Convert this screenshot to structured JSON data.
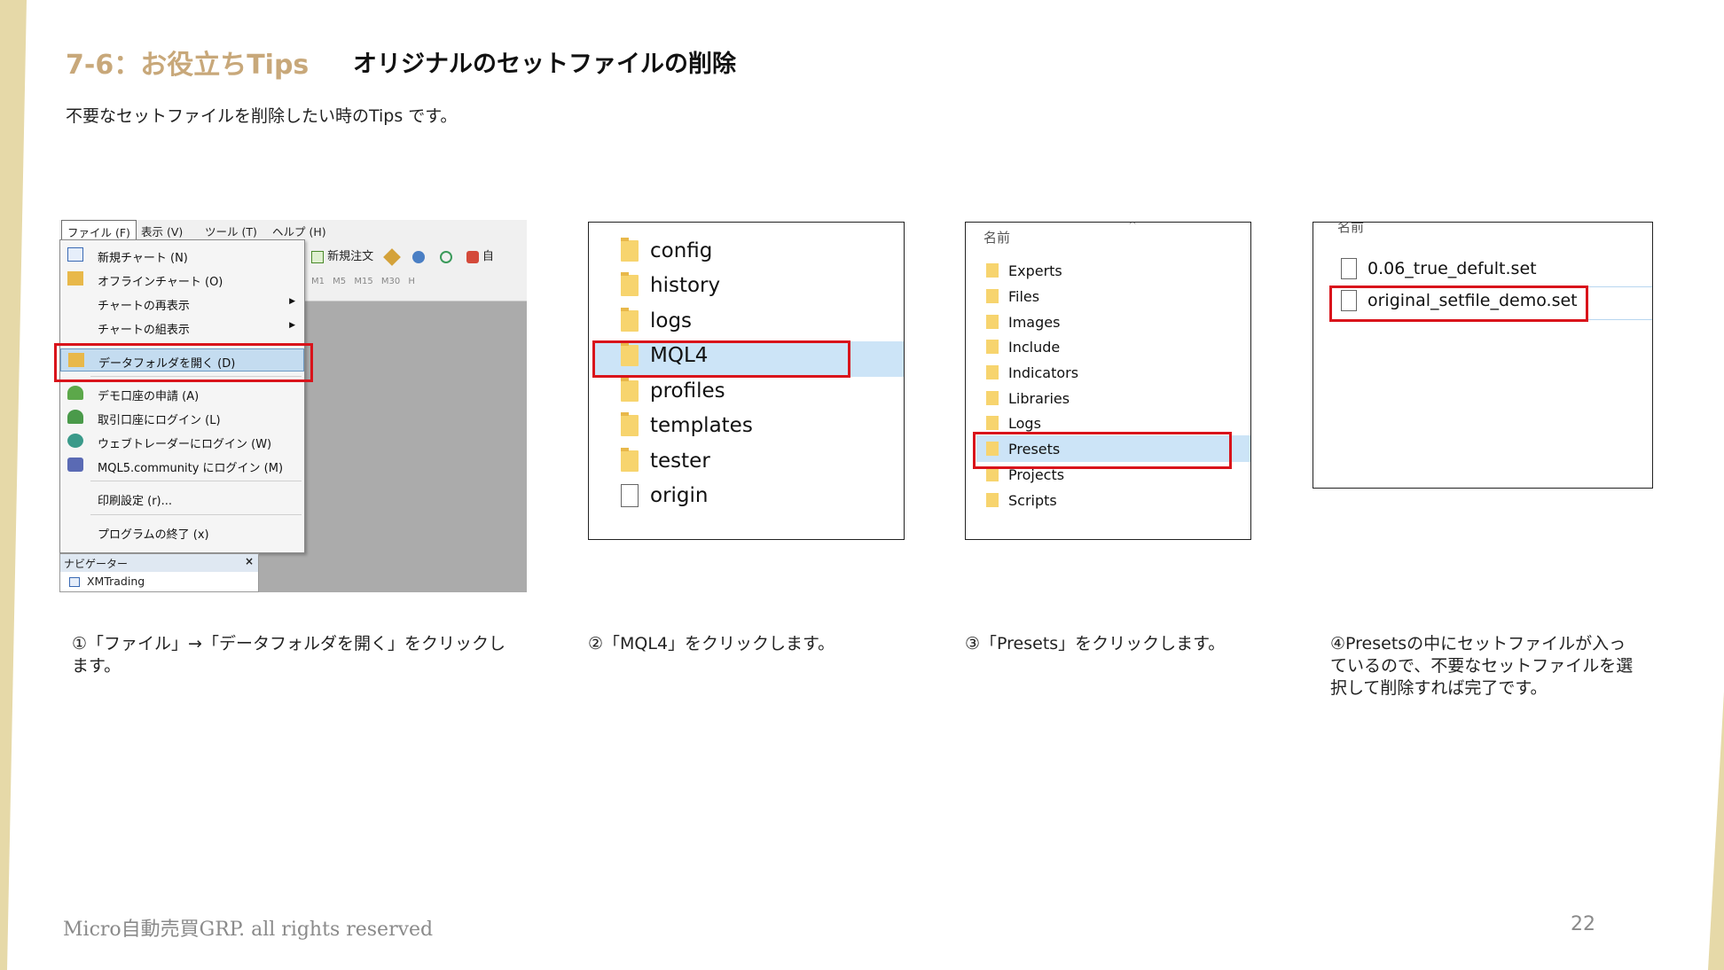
{
  "header": {
    "section_tag": "7-6：お役立ちTips",
    "title": "オリジナルのセットファイルの削除",
    "subtitle": "不要なセットファイルを削除したい時のTips です。"
  },
  "colors": {
    "accent_gold": "#c8a87a",
    "highlight_red": "#d9141b",
    "selection_blue": "#cce4f7"
  },
  "step1": {
    "menubar": [
      "ファイル (F)",
      "表示 (V)",
      "ツール (T)",
      "ヘルプ (H)"
    ],
    "toolbar_label": "新規注文",
    "toolbar_extra": "自",
    "timeframes": "M1 M5 M15 M30 H",
    "menu_items": [
      {
        "label": "新規チャート (N)",
        "icon": "new-chart-icon"
      },
      {
        "label": "オフラインチャート (O)",
        "icon": "folder-open-icon"
      },
      {
        "label": "チャートの再表示",
        "icon": ""
      },
      {
        "label": "チャートの組表示",
        "icon": ""
      },
      {
        "label": "データフォルダを開く (D)",
        "icon": "folder-open-icon"
      },
      {
        "label": "デモ口座の申請 (A)",
        "icon": "user-add-icon"
      },
      {
        "label": "取引口座にログイン (L)",
        "icon": "user-login-icon"
      },
      {
        "label": "ウェブトレーダーにログイン (W)",
        "icon": "globe-icon"
      },
      {
        "label": "MQL5.community にログイン (M)",
        "icon": "community-icon"
      },
      {
        "label": "印刷設定 (r)...",
        "icon": ""
      },
      {
        "label": "プログラムの終了 (x)",
        "icon": ""
      }
    ],
    "navigator_title": "ナビゲーター",
    "navigator_close": "×",
    "navigator_item": "XMTrading",
    "caption": "①「ファイル」→「データフォルダを開く」をクリックします。"
  },
  "step2": {
    "folders": [
      "config",
      "history",
      "logs",
      "MQL4",
      "profiles",
      "templates",
      "tester"
    ],
    "files": [
      "origin"
    ],
    "caption": "②「MQL4」をクリックします。"
  },
  "step3": {
    "column_header": "名前",
    "folders": [
      "Experts",
      "Files",
      "Images",
      "Include",
      "Indicators",
      "Libraries",
      "Logs",
      "Presets",
      "Projects",
      "Scripts"
    ],
    "caption": "③「Presets」をクリックします。"
  },
  "step4": {
    "column_header": "名前",
    "files": [
      "0.06_true_defult.set",
      "original_setfile_demo.set"
    ],
    "caption": "④Presetsの中にセットファイルが入っているので、不要なセットファイルを選択して削除すれば完了です。"
  },
  "footer": {
    "copyright": "Micro自動売買GRP. all rights reserved",
    "page_number": "22"
  }
}
